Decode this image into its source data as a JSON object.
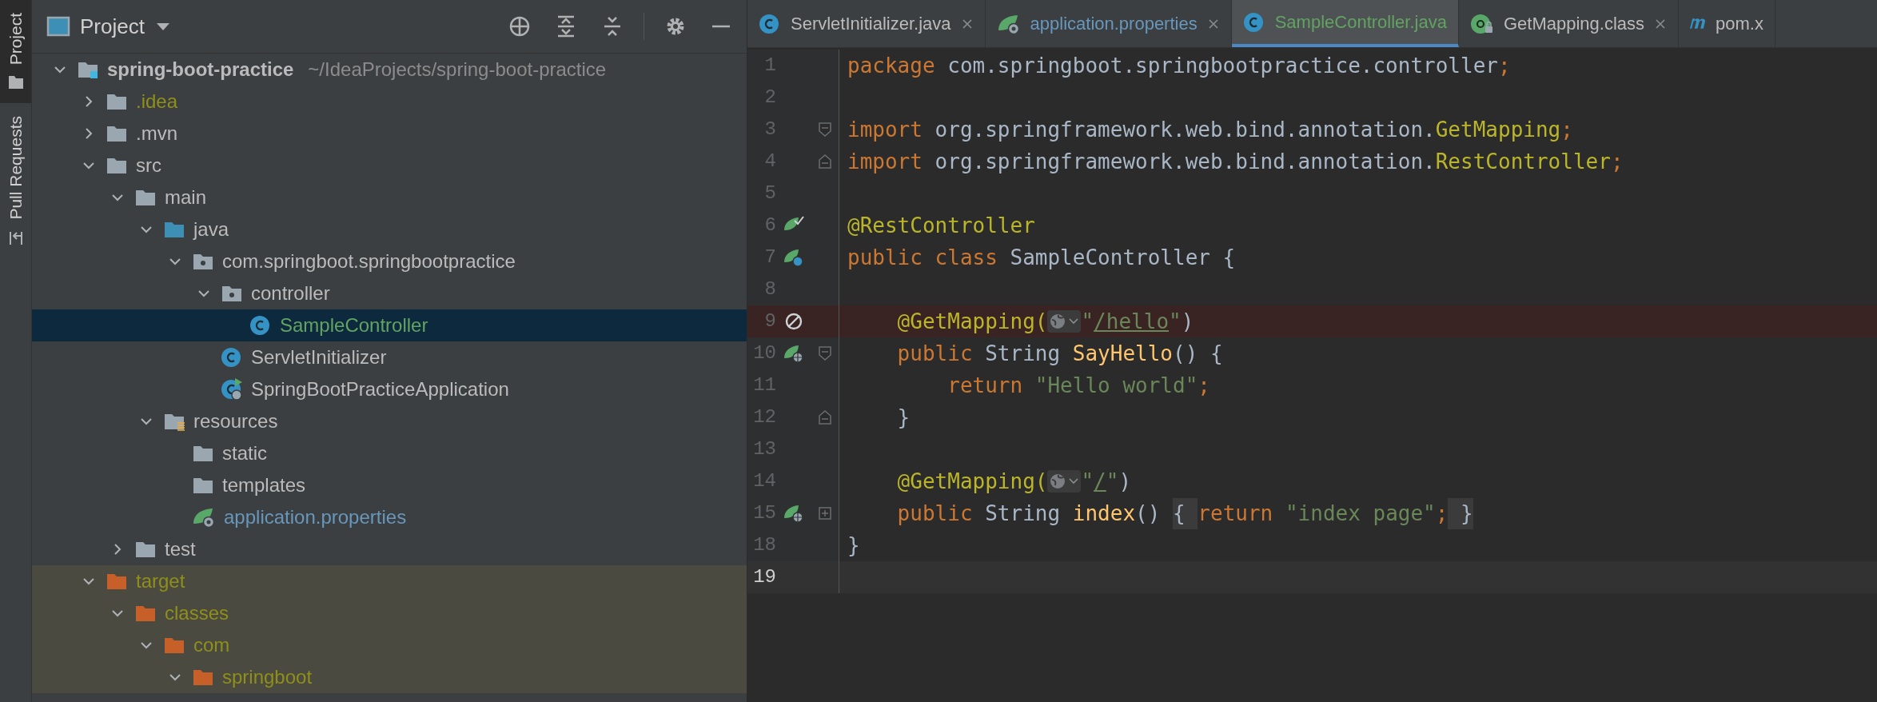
{
  "tool_strip": {
    "tabs": [
      {
        "label": "Project",
        "selected": true
      },
      {
        "label": "Pull Requests",
        "selected": false
      }
    ]
  },
  "project_panel": {
    "title": "Project"
  },
  "tree": [
    {
      "label": "spring-boot-practice",
      "hint": "~/IdeaProjects/spring-boot-practice",
      "kind": "project",
      "color": "#bbbbbb",
      "expanded": true,
      "selected": false,
      "children": [
        {
          "label": ".idea",
          "kind": "folder",
          "color": "#8f8f1a",
          "expanded": false,
          "selected": false
        },
        {
          "label": ".mvn",
          "kind": "folder",
          "color": "#bbbbbb",
          "expanded": false,
          "selected": false
        },
        {
          "label": "src",
          "kind": "folder",
          "color": "#bbbbbb",
          "expanded": true,
          "selected": false,
          "children": [
            {
              "label": "main",
              "kind": "folder",
              "color": "#bbbbbb",
              "expanded": true,
              "selected": false,
              "children": [
                {
                  "label": "java",
                  "kind": "source-folder",
                  "color": "#bbbbbb",
                  "expanded": true,
                  "selected": false,
                  "children": [
                    {
                      "label": "com.springboot.springbootpractice",
                      "kind": "package",
                      "color": "#bbbbbb",
                      "expanded": true,
                      "selected": false,
                      "children": [
                        {
                          "label": "controller",
                          "kind": "package",
                          "color": "#bbbbbb",
                          "expanded": true,
                          "selected": false,
                          "children": [
                            {
                              "label": "SampleController",
                              "kind": "class",
                              "color": "#62a362",
                              "selected": true
                            }
                          ]
                        },
                        {
                          "label": "ServletInitializer",
                          "kind": "class",
                          "color": "#bbbbbb",
                          "selected": false
                        },
                        {
                          "label": "SpringBootPracticeApplication",
                          "kind": "spring-class",
                          "color": "#bbbbbb",
                          "selected": false
                        }
                      ]
                    }
                  ]
                },
                {
                  "label": "resources",
                  "kind": "resources-folder",
                  "color": "#bbbbbb",
                  "expanded": true,
                  "selected": false,
                  "children": [
                    {
                      "label": "static",
                      "kind": "folder",
                      "color": "#bbbbbb",
                      "selected": false
                    },
                    {
                      "label": "templates",
                      "kind": "folder",
                      "color": "#bbbbbb",
                      "selected": false
                    },
                    {
                      "label": "application.properties",
                      "kind": "properties",
                      "color": "#6897bb",
                      "selected": false
                    }
                  ]
                }
              ]
            },
            {
              "label": "test",
              "kind": "folder",
              "color": "#bbbbbb",
              "expanded": false,
              "selected": false
            }
          ]
        },
        {
          "label": "target",
          "kind": "excluded-folder",
          "color": "#8f8f1a",
          "expanded": true,
          "selected": false,
          "children": [
            {
              "label": "classes",
              "kind": "excluded-folder",
              "color": "#8f8f1a",
              "expanded": true,
              "selected": false,
              "children": [
                {
                  "label": "com",
                  "kind": "excluded-folder",
                  "color": "#8f8f1a",
                  "expanded": true,
                  "selected": false,
                  "children": [
                    {
                      "label": "springboot",
                      "kind": "excluded-folder",
                      "color": "#8f8f1a",
                      "expanded": true,
                      "selected": false
                    }
                  ]
                }
              ]
            }
          ]
        }
      ]
    }
  ],
  "editor_tabs": [
    {
      "label": "ServletInitializer.java",
      "kind": "class",
      "color": "#bbbbbb",
      "selected": false,
      "closable": true
    },
    {
      "label": "application.properties",
      "kind": "properties",
      "color": "#6897bb",
      "selected": false,
      "closable": true
    },
    {
      "label": "SampleController.java",
      "kind": "class",
      "color": "#62a362",
      "selected": true,
      "closable": false
    },
    {
      "label": "GetMapping.class",
      "kind": "annotation",
      "color": "#bbbbbb",
      "selected": false,
      "closable": true
    },
    {
      "label": "pom.x",
      "kind": "maven",
      "color": "#bbbbbb",
      "selected": false,
      "closable": false
    }
  ],
  "code_lines": [
    {
      "number": "1",
      "highlighted": false,
      "current": false,
      "tokens": [
        {
          "kind": "keyword",
          "text": "package"
        },
        {
          "kind": "plain",
          "text": " com.springboot.springbootpractice.controller"
        },
        {
          "kind": "keyword",
          "text": ";"
        }
      ]
    },
    {
      "number": "2",
      "highlighted": false,
      "current": false
    },
    {
      "number": "3",
      "highlighted": false,
      "current": false,
      "fold": {
        "kind": "start"
      },
      "tokens": [
        {
          "kind": "keyword",
          "text": "import"
        },
        {
          "kind": "plain",
          "text": " org.springframework.web.bind.annotation."
        },
        {
          "kind": "annotation",
          "text": "GetMapping"
        },
        {
          "kind": "keyword",
          "text": ";"
        }
      ]
    },
    {
      "number": "4",
      "highlighted": false,
      "current": false,
      "fold": {
        "kind": "end"
      },
      "tokens": [
        {
          "kind": "keyword",
          "text": "import"
        },
        {
          "kind": "plain",
          "text": " org.springframework.web.bind.annotation."
        },
        {
          "kind": "annotation",
          "text": "RestController"
        },
        {
          "kind": "keyword",
          "text": ";"
        }
      ]
    },
    {
      "number": "5",
      "highlighted": false,
      "current": false
    },
    {
      "number": "6",
      "highlighted": false,
      "current": false,
      "gutter_icon": {
        "kind": "bean-check"
      },
      "tokens": [
        {
          "kind": "annotation",
          "text": "@RestController"
        }
      ]
    },
    {
      "number": "7",
      "highlighted": false,
      "current": false,
      "gutter_icon": {
        "kind": "bean-class"
      },
      "tokens": [
        {
          "kind": "keyword",
          "text": "public class"
        },
        {
          "kind": "plain",
          "text": " SampleController {"
        }
      ]
    },
    {
      "number": "8",
      "highlighted": false,
      "current": false
    },
    {
      "number": "9",
      "highlighted": true,
      "current": false,
      "gutter_icon": {
        "kind": "disabled"
      },
      "tokens": [
        {
          "kind": "annotation",
          "text": "    @GetMapping("
        },
        {
          "kind": "hint"
        },
        {
          "kind": "string",
          "text": "\""
        },
        {
          "kind": "link",
          "text": "/hello"
        },
        {
          "kind": "string",
          "text": "\""
        },
        {
          "kind": "plain",
          "text": ")"
        }
      ]
    },
    {
      "number": "10",
      "highlighted": false,
      "current": false,
      "gutter_icon": {
        "kind": "bean-web"
      },
      "fold": {
        "kind": "start"
      },
      "tokens": [
        {
          "kind": "keyword",
          "text": "    public"
        },
        {
          "kind": "plain",
          "text": " String "
        },
        {
          "kind": "method",
          "text": "SayHello"
        },
        {
          "kind": "plain",
          "text": "() {"
        }
      ]
    },
    {
      "number": "11",
      "highlighted": false,
      "current": false,
      "tokens": [
        {
          "kind": "keyword",
          "text": "        return"
        },
        {
          "kind": "string",
          "text": " \"Hello world\""
        },
        {
          "kind": "keyword",
          "text": ";"
        }
      ]
    },
    {
      "number": "12",
      "highlighted": false,
      "current": false,
      "fold": {
        "kind": "end"
      },
      "tokens": [
        {
          "kind": "plain",
          "text": "    }"
        }
      ]
    },
    {
      "number": "13",
      "highlighted": false,
      "current": false
    },
    {
      "number": "14",
      "highlighted": false,
      "current": false,
      "tokens": [
        {
          "kind": "annotation",
          "text": "    @GetMapping("
        },
        {
          "kind": "hint"
        },
        {
          "kind": "string",
          "text": "\""
        },
        {
          "kind": "link",
          "text": "/"
        },
        {
          "kind": "string",
          "text": "\""
        },
        {
          "kind": "plain",
          "text": ")"
        }
      ]
    },
    {
      "number": "15",
      "highlighted": false,
      "current": false,
      "gutter_icon": {
        "kind": "bean-web"
      },
      "fold": {
        "kind": "collapsed"
      },
      "tokens": [
        {
          "kind": "keyword",
          "text": "    public"
        },
        {
          "kind": "plain",
          "text": " String "
        },
        {
          "kind": "method",
          "text": "index"
        },
        {
          "kind": "plain",
          "text": "() "
        },
        {
          "kind": "folded",
          "text": "{ "
        },
        {
          "kind": "keyword",
          "text": "return"
        },
        {
          "kind": "string",
          "text": " \"index page\""
        },
        {
          "kind": "keyword",
          "text": ";"
        },
        {
          "kind": "folded",
          "text": " }"
        }
      ]
    },
    {
      "number": "18",
      "highlighted": false,
      "current": false,
      "tokens": [
        {
          "kind": "plain",
          "text": "}"
        }
      ]
    },
    {
      "number": "19",
      "highlighted": false,
      "current": true
    }
  ]
}
